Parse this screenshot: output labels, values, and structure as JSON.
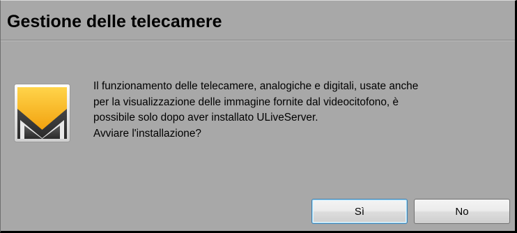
{
  "dialog": {
    "title": "Gestione delle telecamere",
    "icon": "app-logo-icon",
    "message_lines": [
      "Il funzionamento delle telecamere, analogiche e digitali, usate anche",
      "per la visualizzazione delle immagine fornite dal videocitofono, è",
      "possibile solo dopo aver installato ULiveServer.",
      "Avviare l'installazione?"
    ],
    "buttons": {
      "yes": "Sì",
      "no": "No"
    }
  },
  "colors": {
    "background": "#a8a8a8",
    "icon_yellow": "#f7b21c",
    "icon_dark": "#3a3a3a",
    "default_button_border": "#3c7fb1"
  }
}
